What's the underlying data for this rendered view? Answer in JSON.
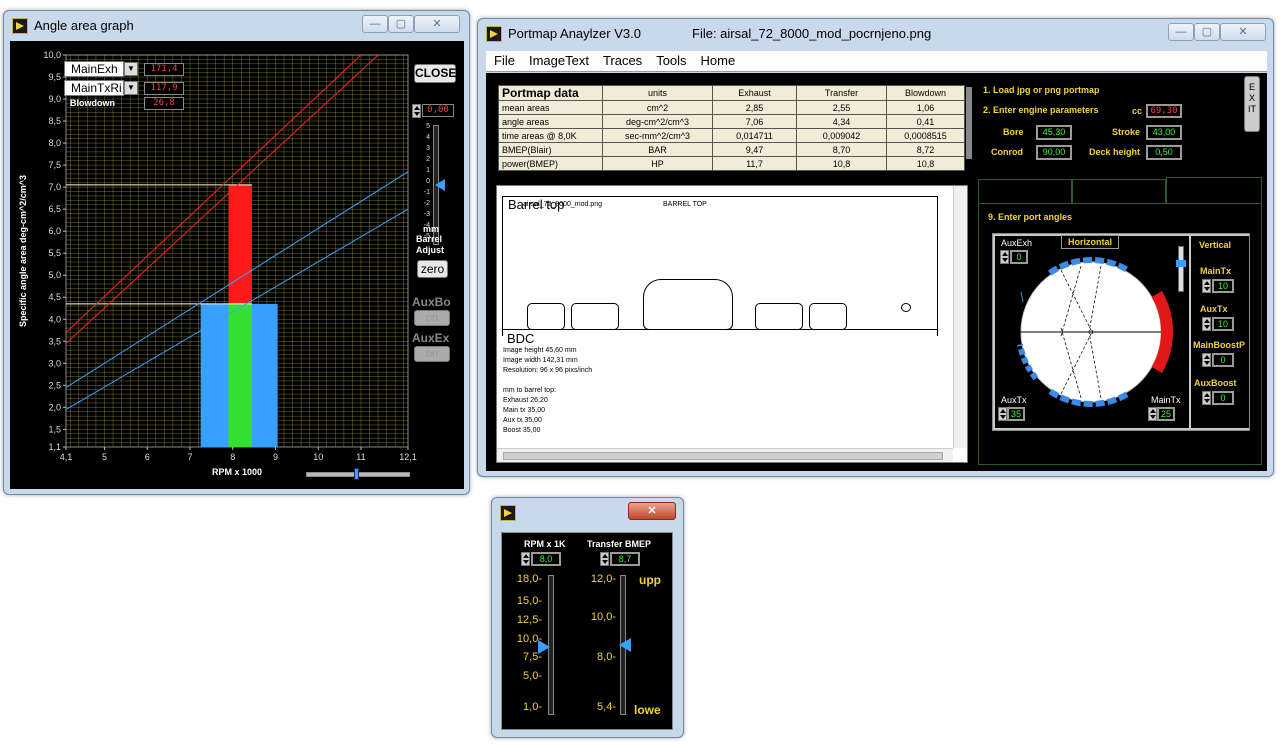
{
  "angle_window": {
    "title": "Angle area graph",
    "close_label": "CLOSE",
    "legend": [
      {
        "name": "MainExh",
        "value": "171,4"
      },
      {
        "name": "MainTxRi",
        "value": "117,9"
      },
      {
        "name": "Blowdown",
        "value": "26,8"
      }
    ],
    "barrel_value": "0,00",
    "barrel_scale": [
      "5",
      "4",
      "3",
      "2",
      "1",
      "0",
      "-1",
      "-2",
      "-3",
      "-4",
      "-5"
    ],
    "barrel_label_1": "mm",
    "barrel_label_2": "Barrel",
    "barrel_label_3": "Adjust",
    "zero_label": "zero",
    "auxbo_label": "AuxBo",
    "auxbo_btn": "on",
    "auxex_label": "AuxEx",
    "auxex_btn": "on"
  },
  "chart_data": {
    "type": "line",
    "xlabel": "RPM x 1000",
    "ylabel": "Specific angle area  deg-cm^2/cm^3",
    "xlim": [
      4.1,
      12.1
    ],
    "ylim": [
      1.1,
      10.0
    ],
    "x_ticks": [
      "4,1",
      "5",
      "6",
      "7",
      "8",
      "9",
      "10",
      "11",
      "12,1"
    ],
    "y_ticks": [
      "10,0",
      "9,5",
      "9,0",
      "8,5",
      "8,0",
      "7,5",
      "7,0",
      "6,5",
      "6,0",
      "5,5",
      "5,0",
      "4,5",
      "4,0",
      "3,5",
      "3,0",
      "2,5",
      "2,0",
      "1,5",
      "1,1"
    ],
    "grid": true,
    "background": "#000000",
    "grid_color": "#c8c84a",
    "lines": [
      {
        "color": "#ff2020",
        "x": [
          4.1,
          11.0
        ],
        "y": [
          3.7,
          10.0
        ]
      },
      {
        "color": "#ff2020",
        "x": [
          4.1,
          11.4
        ],
        "y": [
          3.45,
          10.0
        ]
      },
      {
        "color": "#3aa0ff",
        "x": [
          4.1,
          12.1
        ],
        "y": [
          2.45,
          7.35
        ]
      },
      {
        "color": "#3aa0ff",
        "x": [
          4.1,
          12.1
        ],
        "y": [
          1.95,
          6.5
        ]
      }
    ],
    "bars": [
      {
        "color": "#3aa0ff",
        "x0": 7.25,
        "x1": 9.05,
        "y": 4.35
      },
      {
        "color": "#33e033",
        "x0": 7.9,
        "x1": 8.45,
        "y": 4.35
      },
      {
        "color": "#ff1a1a",
        "x0": 7.9,
        "x1": 8.45,
        "y0": 4.35,
        "y1": 7.05
      }
    ],
    "hlines": [
      7.05,
      4.35
    ],
    "rpm_slider": 8.0
  },
  "portmap_window": {
    "title": "Portmap Anaylzer V3.0",
    "file_label": "File: airsal_72_8000_mod_pocrnjeno.png",
    "menu": [
      "File",
      "ImageText",
      "Traces",
      "Tools",
      "Home"
    ],
    "table": {
      "headers": [
        "Portmap data",
        "units",
        "Exhaust",
        "Transfer",
        "Blowdown"
      ],
      "rows": [
        [
          "mean areas",
          "cm^2",
          "2,85",
          "2,55",
          "1,06"
        ],
        [
          "angle areas",
          "deg-cm^2/cm^3",
          "7,06",
          "4,34",
          "0,41"
        ],
        [
          "time areas @ 8,0K",
          "sec-mm^2/cm^3",
          "0,014711",
          "0,009042",
          "0,0008515"
        ],
        [
          "BMEP(Blair)",
          "BAR",
          "9,47",
          "8,70",
          "8,72"
        ],
        [
          "power(BMEP)",
          "HP",
          "11,7",
          "10,8",
          "10,8"
        ]
      ]
    },
    "steps": {
      "step1": "1. Load jpg or png portmap",
      "step2": "2. Enter engine parameters",
      "step9": "9. Enter port angles"
    },
    "params": {
      "cc_label": "cc",
      "cc": "69,30",
      "bore_label": "Bore",
      "bore": "45,30",
      "stroke_label": "Stroke",
      "stroke": "43,00",
      "conrod_label": "Conrod",
      "conrod": "90,00",
      "deck_label": "Deck height",
      "deck": "0,50"
    },
    "exit_label": "EXIT",
    "image": {
      "barrel_top": "Barrel top",
      "file_small": "airsal_72_8000_mod.png",
      "barrel_top_caps": "BARREL TOP",
      "bdc": "BDC",
      "info": [
        "Image height  45,60 mm",
        "Image width  142,31 mm",
        "Resolution: 96 x 96 pixs/inch",
        "",
        "mm to barrel top:",
        "Exhaust  26,20",
        "Main tx   35,00",
        "Aux tx    35,00",
        "Boost     35,00"
      ]
    },
    "angles": {
      "auxexh_label": "AuxExh",
      "auxexh": "0",
      "horizontal": "Horizontal",
      "auxtx_label": "AuxTx",
      "auxtx": "35",
      "maintx_label": "MainTx",
      "maintx": "25",
      "vertical": "Vertical",
      "v_maintx_label": "MainTx",
      "v_maintx": "10",
      "v_auxtx_label": "AuxTx",
      "v_auxtx": "10",
      "v_mainboost_label": "MainBoostP",
      "v_mainboost": "0",
      "v_auxboost_label": "AuxBoost",
      "v_auxboost": "0"
    }
  },
  "slider_window": {
    "rpm_label": "RPM x 1K",
    "rpm_value": "8,0",
    "rpm_scale": [
      "18,0",
      "15,0",
      "12,5",
      "10,0",
      "7,5",
      "5,0",
      "1,0"
    ],
    "rpm_level": 8.0,
    "bmep_label": "Transfer BMEP",
    "bmep_value": "8,7",
    "bmep_scale": [
      "12,0",
      "10,0",
      "8,0",
      "5,4"
    ],
    "bmep_level": 8.7,
    "upp": "upp",
    "lowe": "lowe"
  }
}
